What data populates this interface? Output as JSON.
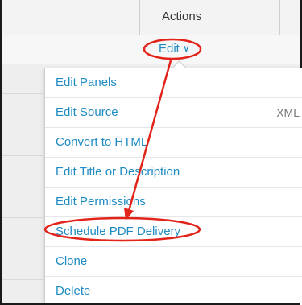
{
  "table": {
    "actions_header": "Actions",
    "edit_label": "Edit"
  },
  "menu": {
    "items": [
      {
        "label": "Edit Panels",
        "suffix": ""
      },
      {
        "label": "Edit Source",
        "suffix": "XML"
      },
      {
        "label": "Convert to HTML",
        "suffix": ""
      },
      {
        "label": "Edit Title or Description",
        "suffix": ""
      },
      {
        "label": "Edit Permissions",
        "suffix": ""
      },
      {
        "label": "Schedule PDF Delivery",
        "suffix": ""
      },
      {
        "label": "Clone",
        "suffix": ""
      },
      {
        "label": "Delete",
        "suffix": ""
      }
    ]
  },
  "colors": {
    "link": "#1e8bc3",
    "annotation": "#e2231a"
  },
  "icons": {
    "edit_chevron": "chevron-down-icon"
  }
}
